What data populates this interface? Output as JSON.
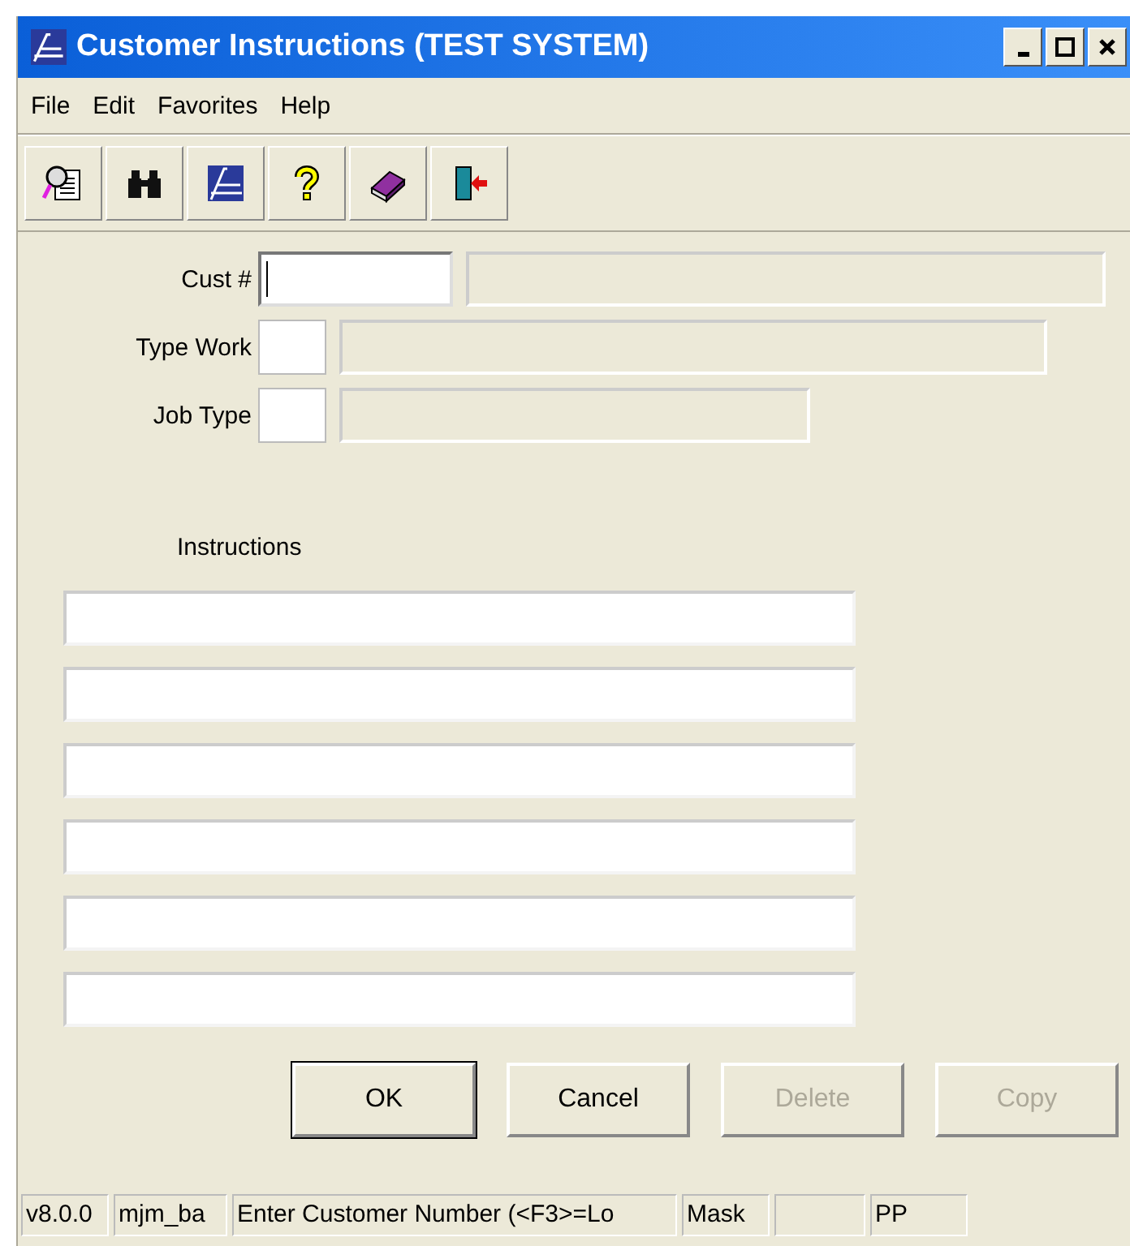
{
  "window": {
    "title": "Customer Instructions (TEST SYSTEM)"
  },
  "menu": [
    "File",
    "Edit",
    "Favorites",
    "Help"
  ],
  "toolbar": [
    {
      "kind": "preview"
    },
    {
      "kind": "find"
    },
    {
      "kind": "logo"
    },
    {
      "kind": "help"
    },
    {
      "kind": "book"
    },
    {
      "kind": "exit"
    }
  ],
  "fields": [
    {
      "label": "Cust #",
      "focused": true
    },
    {
      "label": "Type Work",
      "focused": false
    },
    {
      "label": "Job Type",
      "focused": false
    }
  ],
  "instructions": {
    "label": "Instructions"
  },
  "buttons": [
    {
      "label": "OK",
      "default": true,
      "disabled": false
    },
    {
      "label": "Cancel",
      "default": false,
      "disabled": false
    },
    {
      "label": "Delete",
      "default": false,
      "disabled": true
    },
    {
      "label": "Copy",
      "default": false,
      "disabled": true
    }
  ],
  "status_bar": [
    "v8.0.0",
    "mjm_ba",
    "Enter Customer Number (<F3>=Lo",
    "Mask",
    "PP"
  ]
}
